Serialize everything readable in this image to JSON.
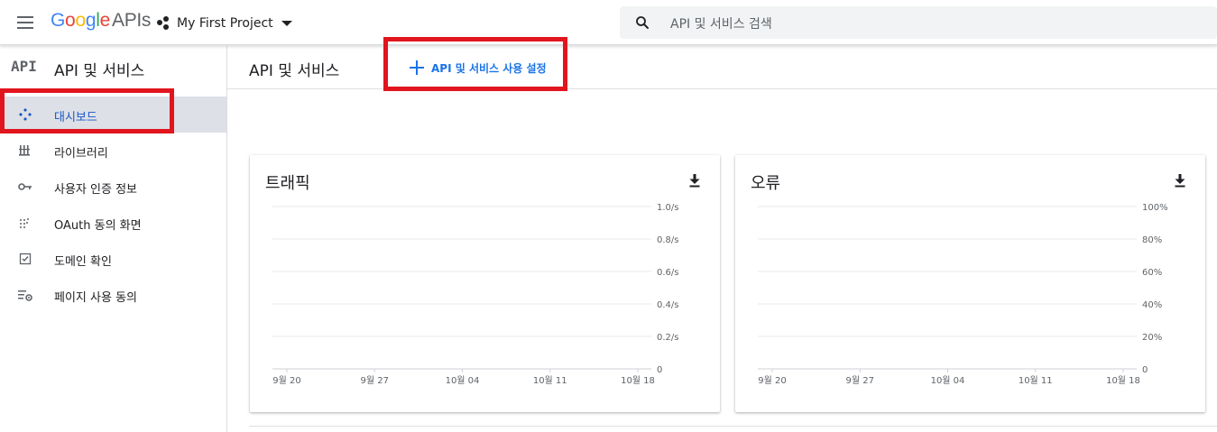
{
  "topbar": {
    "logo": {
      "google": [
        "G",
        "o",
        "o",
        "g",
        "l",
        "e"
      ],
      "google_colors": [
        "#4285F4",
        "#EA4335",
        "#FBBC05",
        "#4285F4",
        "#34A853",
        "#EA4335"
      ],
      "apis": "APIs"
    },
    "project_name": "My First Project",
    "search_placeholder": "API 및 서비스 검색",
    "icons": {
      "menu": "hamburger-menu-icon",
      "project": "project-dots-icon",
      "caret": "caret-down-icon",
      "search": "search-icon"
    }
  },
  "sidebar": {
    "mark": "API",
    "title": "API 및 서비스",
    "items": [
      {
        "label": "대시보드",
        "icon": "dashboard-icon",
        "active": true
      },
      {
        "label": "라이브러리",
        "icon": "library-icon",
        "active": false
      },
      {
        "label": "사용자 인증 정보",
        "icon": "key-icon",
        "active": false
      },
      {
        "label": "OAuth 동의 화면",
        "icon": "oauth-consent-icon",
        "active": false
      },
      {
        "label": "도메인 확인",
        "icon": "checkbox-icon",
        "active": false
      },
      {
        "label": "페이지 사용 동의",
        "icon": "settings-list-icon",
        "active": false
      }
    ]
  },
  "main": {
    "title": "API 및 서비스",
    "enable_button": "API 및 서비스 사용 설정"
  },
  "colors": {
    "accent": "#1a73e8",
    "highlight": "#e1151e",
    "grid": "#e8eaed",
    "tick": "#5f6368"
  },
  "chart_data": [
    {
      "type": "line",
      "title": "트래픽",
      "x": [
        "9월 20",
        "9월 27",
        "10월 04",
        "10월 11",
        "10월 18"
      ],
      "y_ticks": [
        "1.0/s",
        "0.8/s",
        "0.6/s",
        "0.4/s",
        "0.2/s",
        "0"
      ],
      "ylim": [
        0,
        1.0
      ],
      "series": [],
      "grid": true,
      "download_icon": "download-icon"
    },
    {
      "type": "line",
      "title": "오류",
      "x": [
        "9월 20",
        "9월 27",
        "10월 04",
        "10월 11",
        "10월 18"
      ],
      "y_ticks": [
        "100%",
        "80%",
        "60%",
        "40%",
        "20%",
        "0"
      ],
      "ylim": [
        0,
        100
      ],
      "series": [],
      "grid": true,
      "download_icon": "download-icon"
    }
  ]
}
